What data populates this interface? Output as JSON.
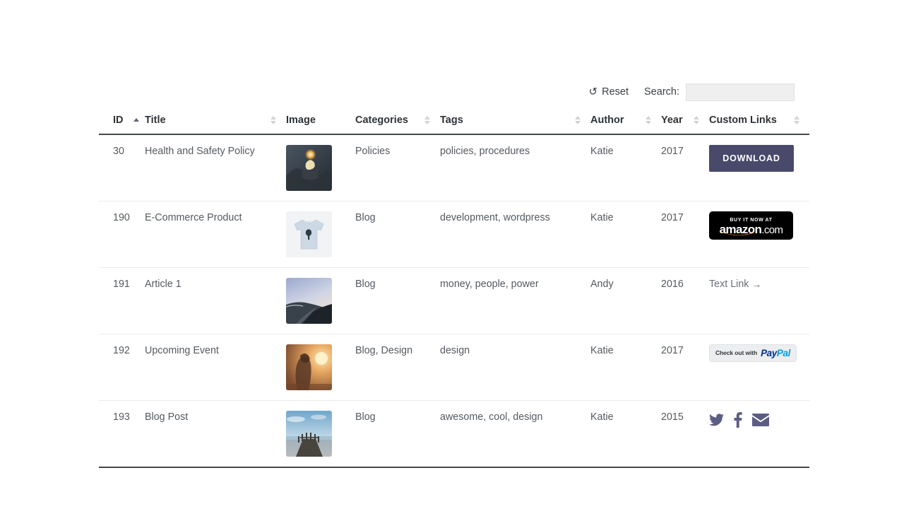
{
  "toolbar": {
    "reset_label": "Reset",
    "reset_icon": "undo-icon",
    "search_label": "Search:",
    "search_value": "",
    "search_placeholder": ""
  },
  "table": {
    "columns": [
      {
        "label": "ID",
        "sortable": true,
        "sort": "asc"
      },
      {
        "label": "Title",
        "sortable": true,
        "sort": "none"
      },
      {
        "label": "Image",
        "sortable": false,
        "sort": "none"
      },
      {
        "label": "Categories",
        "sortable": true,
        "sort": "none"
      },
      {
        "label": "Tags",
        "sortable": true,
        "sort": "none"
      },
      {
        "label": "Author",
        "sortable": true,
        "sort": "none"
      },
      {
        "label": "Year",
        "sortable": true,
        "sort": "none"
      },
      {
        "label": "Custom Links",
        "sortable": true,
        "sort": "none"
      }
    ],
    "rows": [
      {
        "id": "30",
        "title": "Health and Safety Policy",
        "image_alt": "hands-holding-light-photo",
        "categories": "Policies",
        "tags": "policies, procedures",
        "author": "Katie",
        "year": "2017",
        "link_type": "download-button",
        "link_label": "DOWNLOAD"
      },
      {
        "id": "190",
        "title": "E-Commerce Product",
        "image_alt": "light-blue-tshirt-photo",
        "categories": "Blog",
        "tags": "development, wordpress",
        "author": "Katie",
        "year": "2017",
        "link_type": "amazon-badge",
        "link_label": "BUY IT NOW AT amazon.com",
        "amazon_top": "BUY IT NOW AT",
        "amazon_name": "amazon",
        "amazon_tld": ".com"
      },
      {
        "id": "191",
        "title": "Article 1",
        "image_alt": "coastal-highway-photo",
        "categories": "Blog",
        "tags": "money, people, power",
        "author": "Andy",
        "year": "2016",
        "link_type": "text-link",
        "link_label": "Text Link",
        "link_arrow": "→"
      },
      {
        "id": "192",
        "title": "Upcoming Event",
        "image_alt": "sunset-silhouette-photo",
        "categories": "Blog, Design",
        "tags": "design",
        "author": "Katie",
        "year": "2017",
        "link_type": "paypal-badge",
        "link_label": "Check out with PayPal",
        "paypal_pre": "Check out with",
        "paypal_pay": "Pay",
        "paypal_pal": "Pal"
      },
      {
        "id": "193",
        "title": "Blog Post",
        "image_alt": "beach-pier-photo",
        "categories": "Blog",
        "tags": "awesome, cool, design",
        "author": "Katie",
        "year": "2015",
        "link_type": "social-icons",
        "social_icons": [
          "twitter-icon",
          "facebook-icon",
          "email-icon"
        ]
      }
    ]
  },
  "colors": {
    "download_button": "#494a6b",
    "social_icon": "#5c5d85",
    "header_rule": "#45484b",
    "row_rule": "#ebebec",
    "text": "#555a60",
    "paypal_blue_dark": "#003087",
    "paypal_blue_light": "#009cde",
    "amazon_orange": "#ff9900"
  }
}
